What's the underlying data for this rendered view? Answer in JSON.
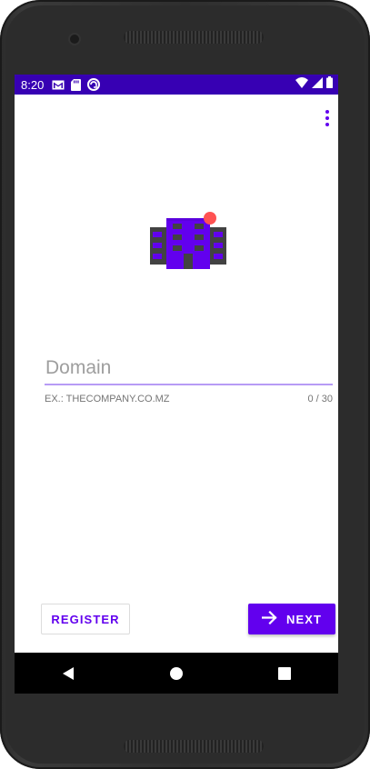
{
  "status_bar": {
    "time": "8:20",
    "icons": [
      "gmail-icon",
      "sd-card-icon",
      "sync-icon",
      "wifi-icon",
      "signal-icon",
      "battery-icon"
    ]
  },
  "app": {
    "overflow_icon": "more-vert-icon",
    "logo_icon": "building-icon",
    "domain_field": {
      "placeholder": "Domain",
      "value": "",
      "helper_text": "EX.: THECOMPANY.CO.MZ",
      "counter": "0 / 30"
    },
    "register_label": "REGISTER",
    "next_label": "NEXT",
    "next_icon": "arrow-forward-icon"
  },
  "nav_bar": {
    "icons": [
      "back-icon",
      "home-icon",
      "recents-icon"
    ]
  },
  "colors": {
    "primary": "#6200ee",
    "primary_dark": "#3700b3",
    "badge": "#ff5252",
    "building_wing": "#424242"
  }
}
